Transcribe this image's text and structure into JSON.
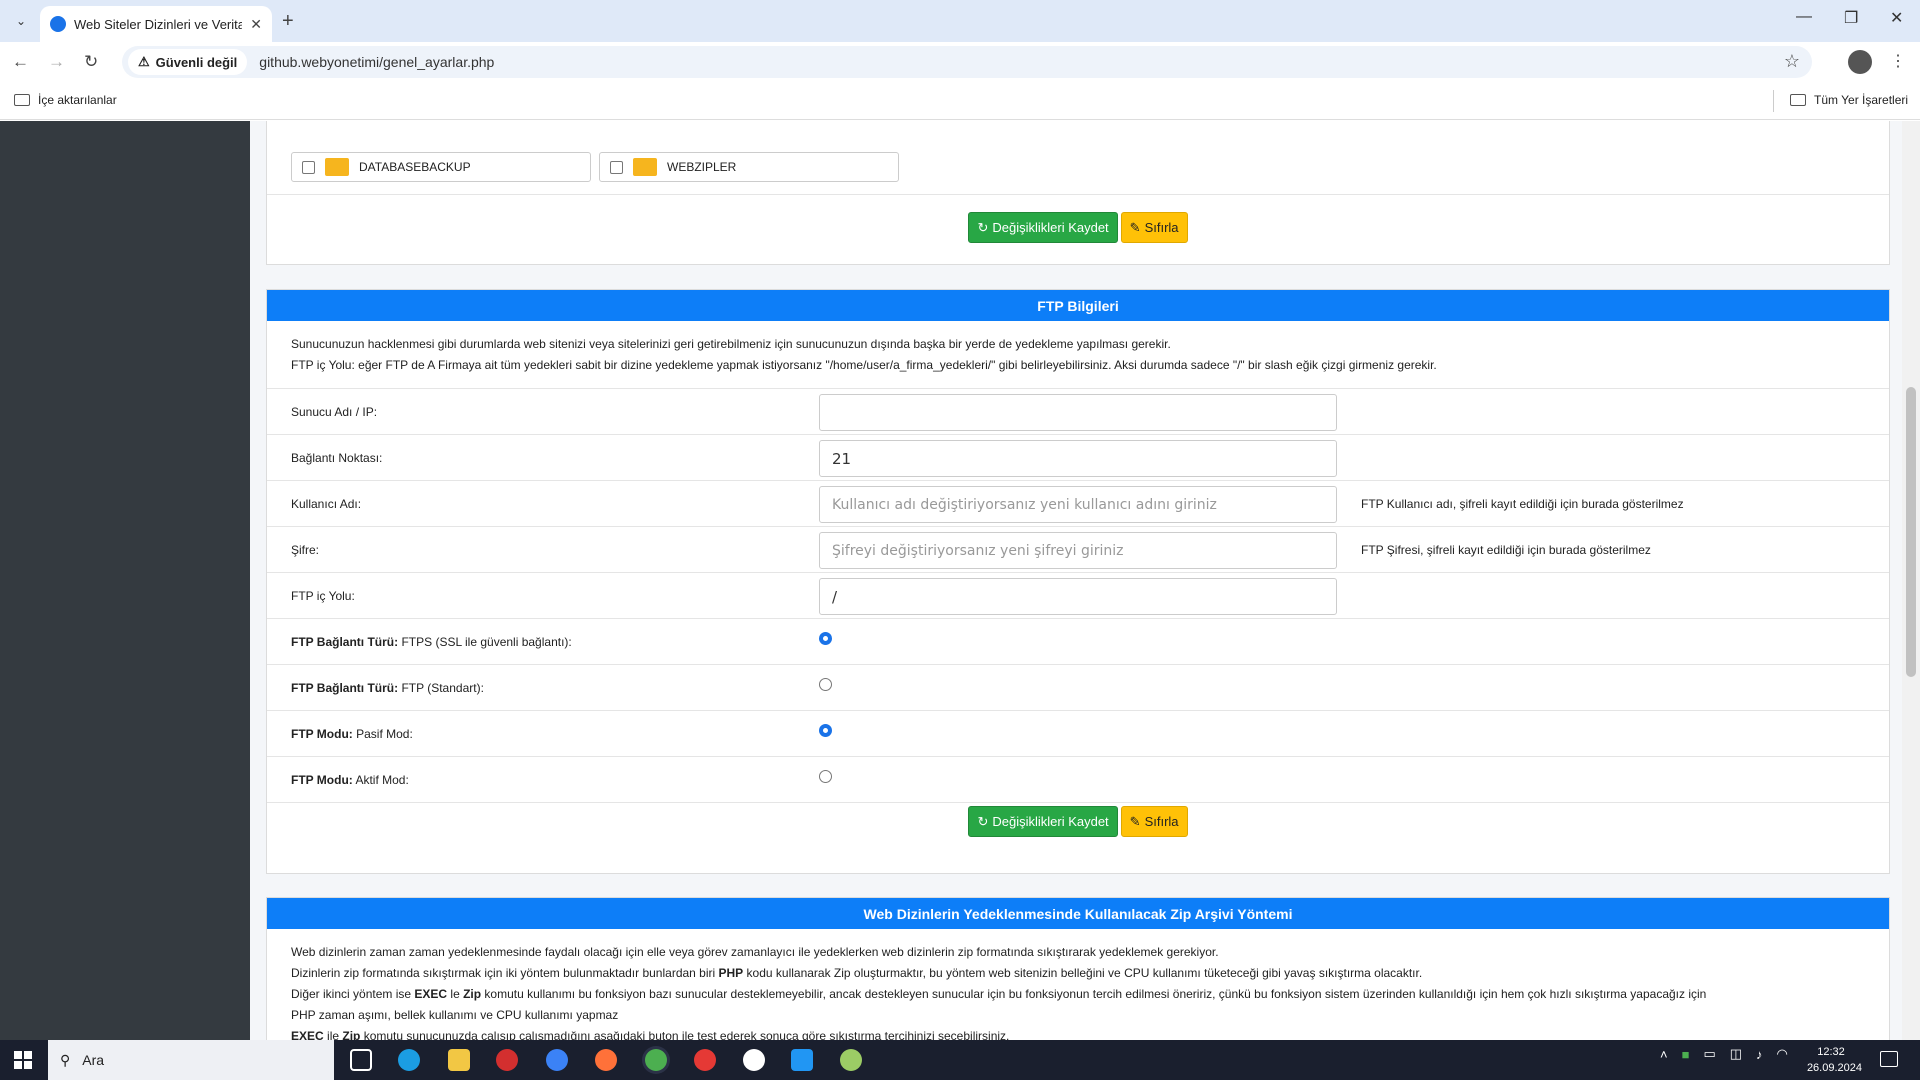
{
  "browser": {
    "tab_title": "Web Siteler Dizinleri ve Veritab",
    "security_label": "Güvenli değil",
    "url": "github.webyonetimi/genel_ayarlar.php",
    "bookmark_left": "İçe aktarılanlar",
    "bookmark_right": "Tüm Yer İşaretleri"
  },
  "backup_dirs": {
    "items": [
      "DATABASEBACKUP",
      "WEBZIPLER"
    ],
    "save_label": "Değişiklikleri Kaydet",
    "reset_label": "Sıfırla"
  },
  "ftp": {
    "header": "FTP Bilgileri",
    "desc_line1": "Sunucunuzun hacklenmesi gibi durumlarda web sitenizi veya sitelerinizi geri getirebilmeniz için sunucunuzun dışında başka bir yerde de yedekleme yapılması gerekir.",
    "desc_line2": "FTP iç Yolu: eğer FTP de A Firmaya ait tüm yedekleri sabit bir dizine yedekleme yapmak istiyorsanız \"/home/user/a_firma_yedekleri/\" gibi belirleyebilirsiniz. Aksi durumda sadece \"/\" bir slash eğik çizgi girmeniz gerekir.",
    "server_label": "Sunucu Adı / IP:",
    "server_value": "",
    "port_label": "Bağlantı Noktası:",
    "port_value": "21",
    "user_label": "Kullanıcı Adı:",
    "user_placeholder": "Kullanıcı adı değiştiriyorsanız yeni kullanıcı adını giriniz",
    "user_note": "FTP Kullanıcı adı, şifreli kayıt edildiği için burada gösterilmez",
    "pass_label": "Şifre:",
    "pass_placeholder": "Şifreyi değiştiriyorsanız yeni şifreyi giriniz",
    "pass_note": "FTP Şifresi, şifreli kayıt edildiği için burada gösterilmez",
    "path_label": "FTP iç Yolu:",
    "path_value": "/",
    "conn_type_bold": "FTP Bağlantı Türü:",
    "ftps_label": " FTPS (SSL ile güvenli bağlantı):",
    "ftps_selected": true,
    "ftp_std_label": " FTP (Standart):",
    "ftp_std_selected": false,
    "mode_bold": "FTP Modu:",
    "passive_label": " Pasif Mod:",
    "passive_selected": true,
    "active_label": " Aktif Mod:",
    "active_selected": false,
    "save_label": "Değişiklikleri Kaydet",
    "reset_label": "Sıfırla"
  },
  "zip": {
    "header": "Web Dizinlerin Yedeklenmesinde Kullanılacak Zip Arşivi Yöntemi",
    "line1": "Web dizinlerin zaman zaman yedeklenmesinde faydalı olacağı için elle veya görev zamanlayıcı ile yedeklerken web dizinlerin zip formatında sıkıştırarak yedeklemek gerekiyor.",
    "line2_a": "Dizinlerin zip formatında sıkıştırmak için iki yöntem bulunmaktadır bunlardan biri ",
    "line2_b": "PHP",
    "line2_c": " kodu kullanarak Zip oluşturmaktır, bu yöntem web sitenizin belleğini ve CPU kullanımı tüketeceği gibi yavaş sıkıştırma olacaktır.",
    "line3_a": "Diğer ikinci yöntem ise ",
    "line3_b": "EXEC",
    "line3_c": " le ",
    "line3_d": "Zip",
    "line3_e": " komutu kullanımı bu fonksiyon bazı sunucular desteklemeyebilir, ancak destekleyen sunucular için bu fonksiyonun tercih edilmesi öneririz, çünkü bu fonksiyon sistem üzerinden kullanıldığı için hem çok hızlı sıkıştırma yapacağız için",
    "line4": "PHP zaman aşımı, bellek kullanımı ve CPU kullanımı yapmaz",
    "line5_a": "EXEC",
    "line5_b": " ile ",
    "line5_c": "Zip",
    "line5_d": " komutu sunucunuzda çalışıp çalışmadığını aşağıdaki buton ile test ederek sonuca göre sıkıştırma tercihinizi seçebilirsiniz."
  },
  "taskbar": {
    "search_label": "Ara",
    "time": "12:32",
    "date": "26.09.2024"
  },
  "colors": {
    "header_blue": "#0d7ef8",
    "save_green": "#28a745",
    "reset_yellow": "#ffc107",
    "sidebar": "#343a40"
  }
}
